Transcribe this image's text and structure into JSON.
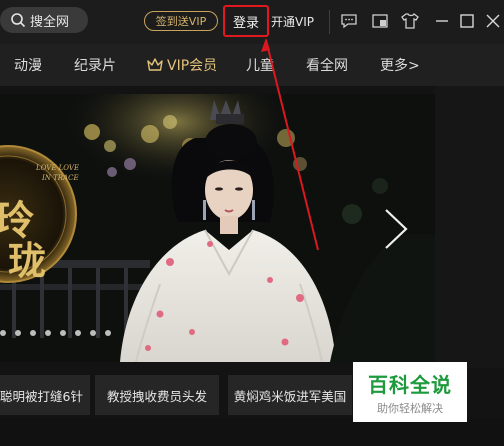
{
  "header": {
    "search_label": "搜全网",
    "signin_vip_label": "签到送VIP",
    "login_label": "登录",
    "open_vip_label": "开通VIP",
    "icons": [
      "search-icon",
      "message-icon",
      "mini-player-icon",
      "skin-tshirt-icon",
      "minimize-icon",
      "maximize-icon",
      "close-icon"
    ]
  },
  "nav": {
    "items": [
      "动漫",
      "纪录片",
      "VIP会员",
      "儿童",
      "看全网",
      "更多>"
    ]
  },
  "banner": {
    "poster_small_text": "LOVE LOVE IN TRACE",
    "poster_title": "玲珑",
    "slide_count": 8
  },
  "captions": [
    "聪明被打缝6针",
    "教授拽收费员头发",
    "黄焖鸡米饭进军美国"
  ],
  "watermark": {
    "main": "百科全说",
    "sub": "助你轻松解决"
  },
  "colors": {
    "login_highlight": "#e0191f",
    "vip_gold": "#d8b46c",
    "watermark_green": "#1d9a3c"
  }
}
